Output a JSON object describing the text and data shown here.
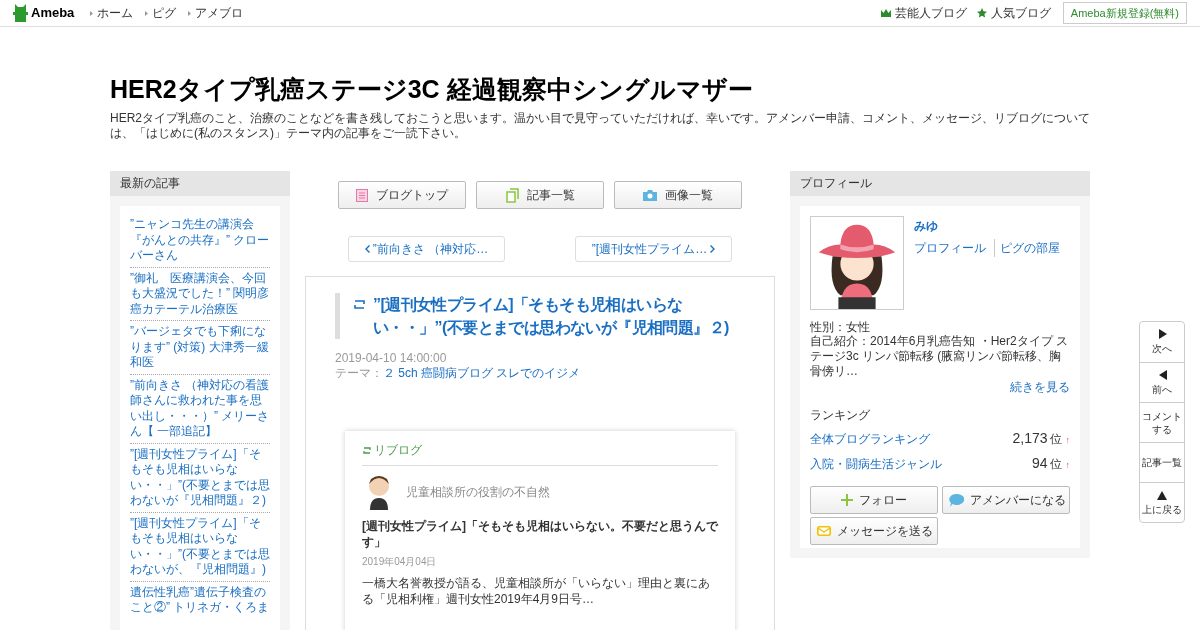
{
  "header": {
    "logo": "Ameba",
    "nav": [
      "ホーム",
      "ピグ",
      "アメブロ"
    ],
    "right_links": [
      {
        "kind": "crown",
        "label": "芸能人ブログ"
      },
      {
        "kind": "star",
        "label": "人気ブログ"
      }
    ],
    "signup": "Ameba新規登録(無料)"
  },
  "blog": {
    "title": "HER2タイプ乳癌ステージ3C 経過観察中シングルマザー",
    "description": "HER2タイプ乳癌のこと、治療のことなどを書き残しておこうと思います。温かい目で見守っていただければ、幸いです。アメンバー申請、コメント、メッセージ、リブログについては、「はじめに(私のスタンス)」テーマ内の記事をご一読下さい。"
  },
  "recent": {
    "heading": "最新の記事",
    "items": [
      "”ニャンコ先生の講演会『がんとの共存』” クローバーさん",
      "”御礼　医療講演会、今回も大盛況でした！” 関明彦癌カテーテル治療医",
      "”バージェタでも下痢になります” (対策) 大津秀一緩和医",
      "”前向きさ （神対応の看護師さんに救われた事を思い出し・・・）” メリーさん【 一部追記】",
      "”[週刊女性プライム]「そもそも児相はいらない・・」”(不要とまでは思わないが『児相問題』２)",
      "”[週刊女性プライム]「そもそも児相はいらない・・」”(不要とまでは思わないが、『児相問題』)",
      "遺伝性乳癌”遺伝子検査のこと②” トリネガ・くろま"
    ]
  },
  "toolbar": [
    {
      "kind": "top",
      "label": "ブログトップ"
    },
    {
      "kind": "list",
      "label": "記事一覧"
    },
    {
      "label": "画像一覧"
    }
  ],
  "pager": {
    "prev": "”前向きさ （神対応…",
    "next": "”[週刊女性プライム…"
  },
  "article": {
    "title": "”[週刊女性プライム]「そもそも児相はいらない・・」”(不要とまでは思わないが『児相問題』２)",
    "date": "2019-04-10 14:00:00",
    "theme_label": "テーマ：",
    "theme": "２ 5ch 癌闘病ブログ スレでのイジメ",
    "reblog": {
      "label": "リブログ",
      "blog_name": "児童相談所の役割の不自然",
      "title": "[週刊女性プライム]「そもそも児相はいらない。不要だと思うんです」",
      "date": "2019年04月04日",
      "excerpt": "一橋大名誉教授が語る、児童相談所が「いらない」理由と裏にある「児相利権」週刊女性2019年4月9日号…"
    }
  },
  "profile": {
    "heading": "プロフィール",
    "name": "みゆ",
    "links": [
      "プロフィール",
      "ピグの部屋"
    ],
    "gender": "性別：女性",
    "intro": "自己紹介：2014年6月乳癌告知 ・Her2タイプ ステージ3c リンパ節転移 (腋窩リンパ節転移、胸骨傍リ…",
    "more": "続きを見る",
    "ranking_heading": "ランキング",
    "rankings": [
      {
        "label": "全体ブログランキング",
        "rank": "2,173",
        "unit": "位",
        "trend": "↑"
      },
      {
        "label": "入院・闘病生活ジャンル",
        "rank": "94",
        "unit": "位",
        "trend": "↑"
      }
    ],
    "buttons": [
      {
        "kind": "follow",
        "label": "フォロー"
      },
      {
        "kind": "amember",
        "label": "アメンバーになる"
      },
      {
        "kind": "message",
        "label": "メッセージを送る"
      }
    ]
  },
  "side_nav": [
    {
      "kind": "next",
      "label": "次へ"
    },
    {
      "kind": "prev",
      "label": "前へ"
    },
    {
      "kind": "comment",
      "label": "コメントする"
    },
    {
      "kind": "list",
      "label": "記事一覧"
    },
    {
      "kind": "up",
      "label": "上に戻る"
    }
  ]
}
